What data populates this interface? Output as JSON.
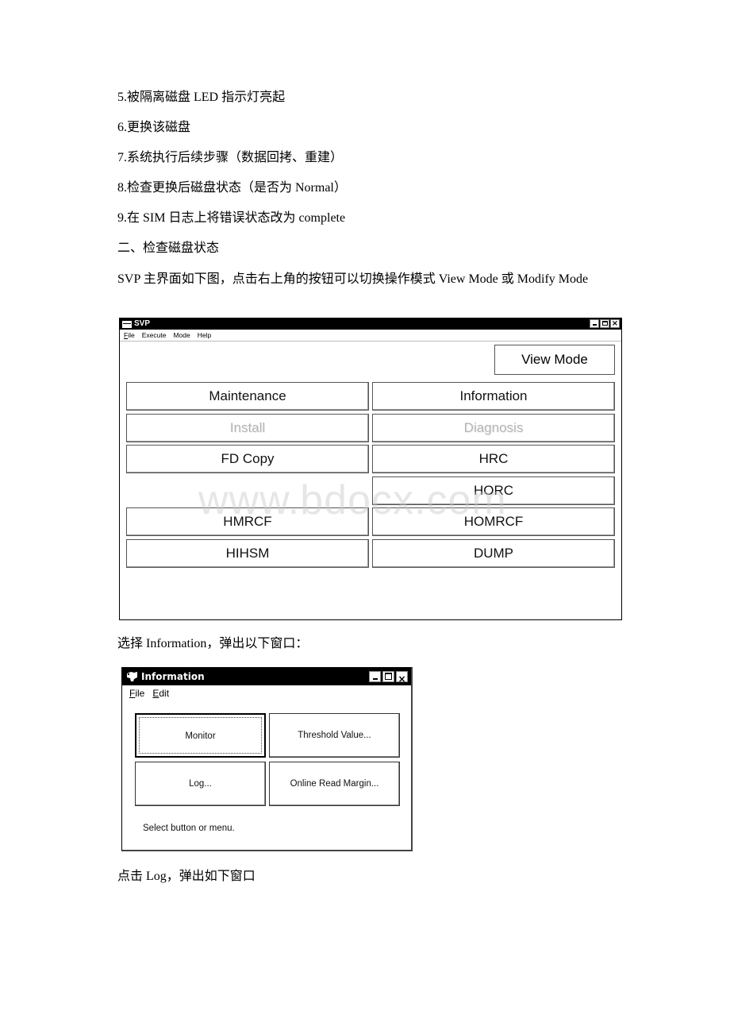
{
  "document": {
    "paragraphs": [
      "5.被隔离磁盘 LED 指示灯亮起",
      "6.更换该磁盘",
      "7.系统执行后续步骤（数据回拷、重建）",
      "8.检查更换后磁盘状态（是否为 Normal）",
      "9.在 SIM 日志上将错误状态改为 complete",
      "二、检查磁盘状态",
      "SVP 主界面如下图，点击右上角的按钮可以切换操作模式 View Mode 或 Modify Mode",
      "选择 Information，弹出以下窗口：",
      "点击 Log，弹出如下窗口"
    ],
    "watermark": "www.bdocx.com"
  },
  "svp_window": {
    "title": "SVP",
    "window_buttons": {
      "minimize": "_",
      "maximize": "□",
      "close": "×"
    },
    "menu": [
      "File",
      "Execute",
      "Mode",
      "Help"
    ],
    "mode_button": "View Mode",
    "buttons": [
      {
        "label": "Maintenance",
        "enabled": true
      },
      {
        "label": "Information",
        "enabled": true
      },
      {
        "label": "Install",
        "enabled": false
      },
      {
        "label": "Diagnosis",
        "enabled": false
      },
      {
        "label": "FD Copy",
        "enabled": true
      },
      {
        "label": "HRC",
        "enabled": true
      },
      {
        "label": "HORC",
        "enabled": true
      },
      {
        "label": "HMRCF",
        "enabled": true
      },
      {
        "label": "HOMRCF",
        "enabled": true
      },
      {
        "label": "HIHSM",
        "enabled": true
      },
      {
        "label": "DUMP",
        "enabled": true
      }
    ]
  },
  "info_window": {
    "title": "Information",
    "window_buttons": {
      "minimize": "_",
      "maximize": "□",
      "close": "×"
    },
    "menu": [
      "File",
      "Edit"
    ],
    "buttons": [
      {
        "label": "Monitor",
        "focused": true
      },
      {
        "label": "Threshold Value...",
        "focused": false
      },
      {
        "label": "Log...",
        "focused": false
      },
      {
        "label": "Online Read Margin...",
        "focused": false
      }
    ],
    "status": "Select button or menu."
  }
}
